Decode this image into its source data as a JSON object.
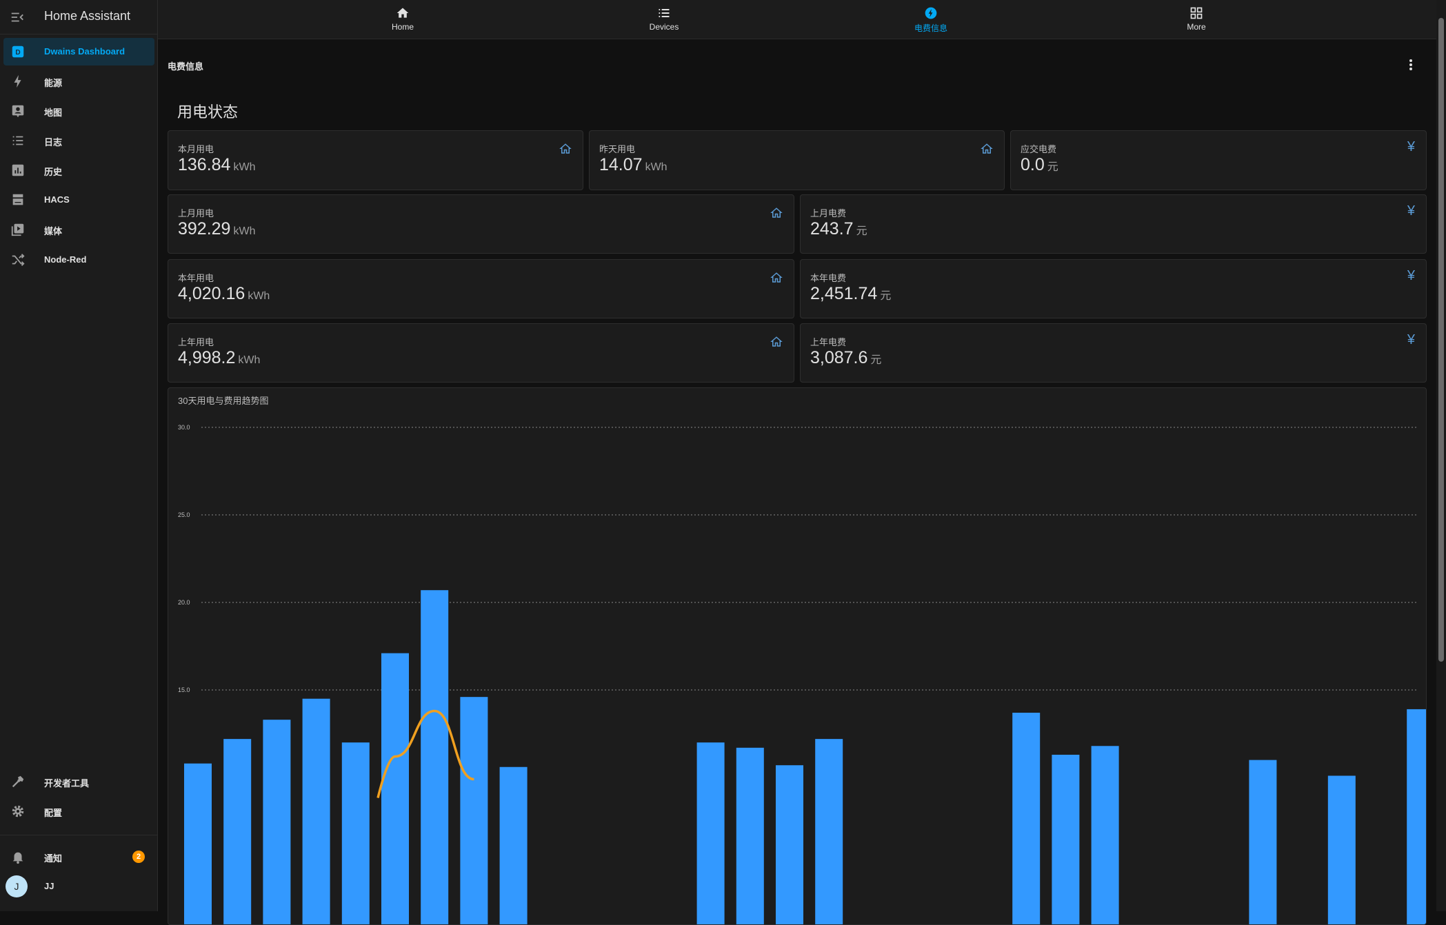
{
  "app": {
    "title": "Home Assistant"
  },
  "sidebar": {
    "items": [
      {
        "label": "Dwains Dashboard",
        "icon": "dashboard-icon",
        "active": true
      },
      {
        "label": "能源",
        "icon": "lightning-icon"
      },
      {
        "label": "地图",
        "icon": "map-account-icon"
      },
      {
        "label": "日志",
        "icon": "list-icon"
      },
      {
        "label": "历史",
        "icon": "chart-box-icon"
      },
      {
        "label": "HACS",
        "icon": "hacs-icon"
      },
      {
        "label": "媒体",
        "icon": "play-box-icon"
      },
      {
        "label": "Node-Red",
        "icon": "shuffle-icon"
      }
    ],
    "bottom": [
      {
        "label": "开发者工具",
        "icon": "hammer-icon"
      },
      {
        "label": "配置",
        "icon": "gear-icon"
      }
    ],
    "notifications": {
      "label": "通知",
      "count": "2"
    },
    "user": {
      "name": "JJ",
      "initial": "J"
    }
  },
  "topnav": {
    "tabs": [
      {
        "label": "Home",
        "icon": "home-icon"
      },
      {
        "label": "Devices",
        "icon": "format-list-icon"
      },
      {
        "label": "电费信息",
        "icon": "lightning-circle-icon",
        "active": true
      },
      {
        "label": "More",
        "icon": "grid-icon"
      }
    ]
  },
  "page": {
    "title": "电费信息",
    "section_title": "用电状态"
  },
  "stats": {
    "month_usage": {
      "name": "本月用电",
      "value": "136.84",
      "unit": "kWh"
    },
    "yesterday_usage": {
      "name": "昨天用电",
      "value": "14.07",
      "unit": "kWh"
    },
    "due_fee": {
      "name": "应交电费",
      "value": "0.0",
      "unit": "元"
    },
    "last_month_usage": {
      "name": "上月用电",
      "value": "392.29",
      "unit": "kWh"
    },
    "last_month_fee": {
      "name": "上月电费",
      "value": "243.7",
      "unit": "元"
    },
    "year_usage": {
      "name": "本年用电",
      "value": "4,020.16",
      "unit": "kWh"
    },
    "year_fee": {
      "name": "本年电费",
      "value": "2,451.74",
      "unit": "元"
    },
    "last_year_usage": {
      "name": "上年用电",
      "value": "4,998.2",
      "unit": "kWh"
    },
    "last_year_fee": {
      "name": "上年电费",
      "value": "3,087.6",
      "unit": "元"
    }
  },
  "colors": {
    "accent": "#03a9f4",
    "bar": "#3399ff",
    "line": "#f0a020",
    "badge": "#ff9800"
  },
  "chart_data": {
    "type": "bar",
    "title": "30天用电与费用趋势图",
    "ylim": [
      10,
      30
    ],
    "yticks": [
      "30.0",
      "25.0",
      "20.0",
      "15.0"
    ],
    "grid": true,
    "series": [
      {
        "type": "bar",
        "values": [
          10.8,
          12.2,
          13.3,
          14.5,
          12.0,
          17.1,
          20.7,
          14.6,
          10.6,
          0,
          0,
          0,
          0,
          12.0,
          11.7,
          10.7,
          12.2,
          0,
          0,
          0,
          0,
          13.7,
          11.3,
          11.8,
          0,
          0,
          0,
          11.0,
          0,
          10.1,
          0,
          13.9
        ]
      },
      {
        "type": "line",
        "values": [
          null,
          null,
          null,
          null,
          null,
          11.2,
          13.8,
          9.9
        ]
      }
    ]
  }
}
